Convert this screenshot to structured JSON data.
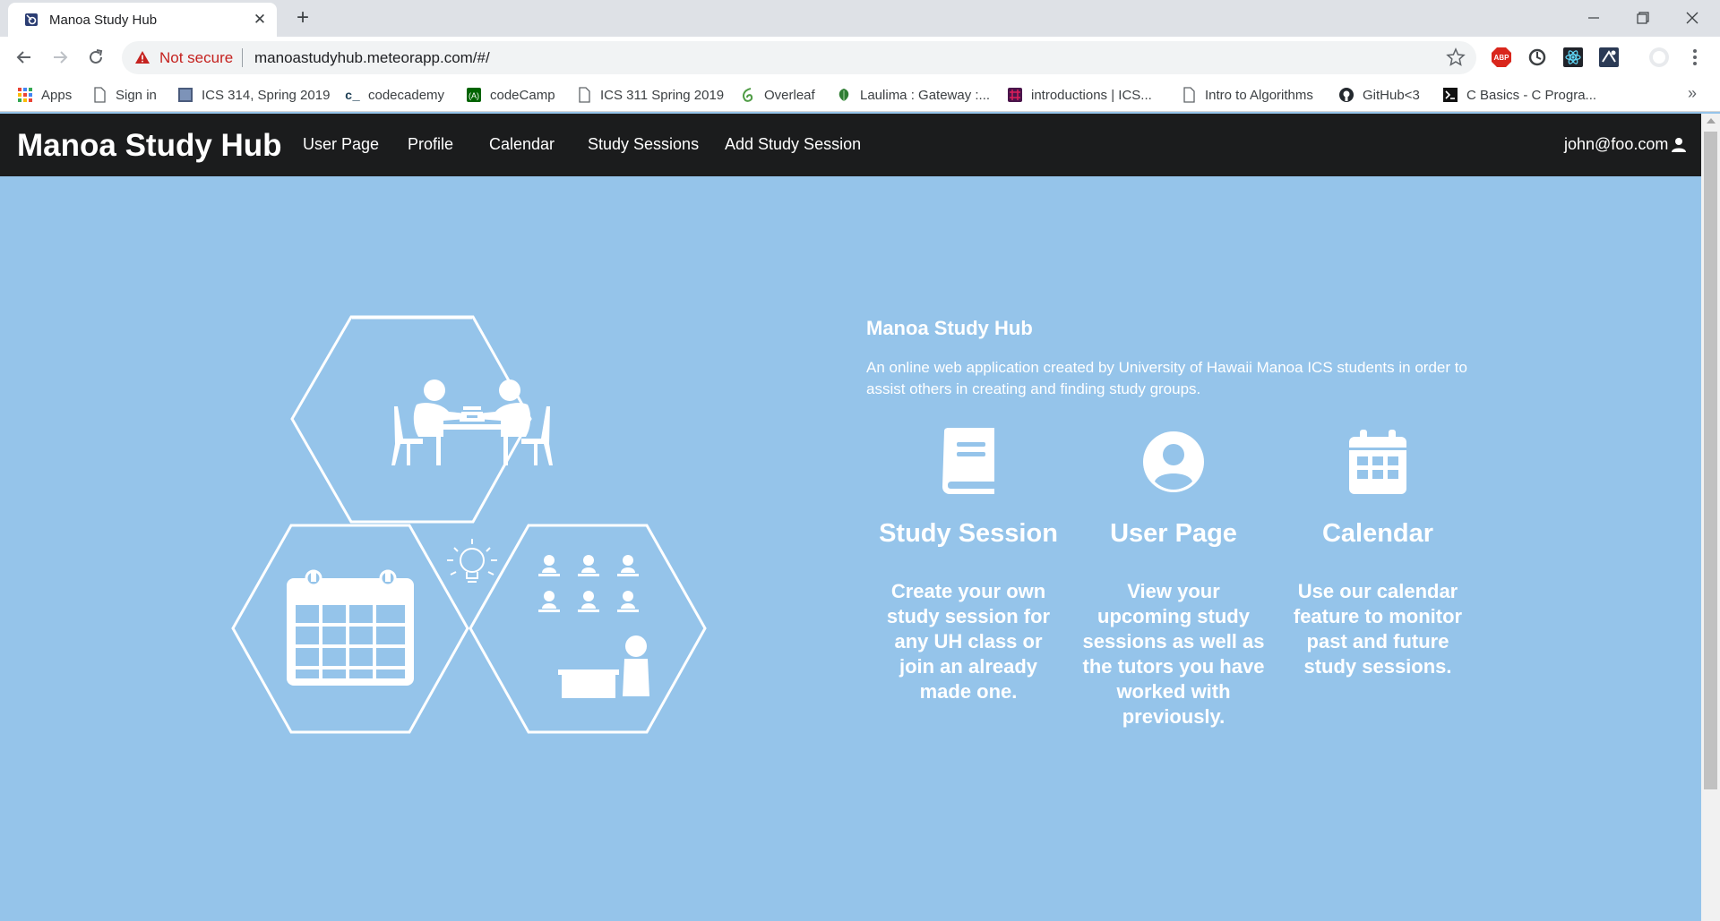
{
  "browser": {
    "tab_title": "Manoa Study Hub",
    "security_label": "Not secure",
    "url": "manoastudyhub.meteorapp.com/#/",
    "bookmarks": [
      {
        "label": "Apps"
      },
      {
        "label": "Sign in"
      },
      {
        "label": "ICS 314, Spring 2019"
      },
      {
        "label": "codecademy"
      },
      {
        "label": "codeCamp"
      },
      {
        "label": "ICS 311 Spring 2019"
      },
      {
        "label": "Overleaf"
      },
      {
        "label": "Laulima : Gateway :..."
      },
      {
        "label": "introductions | ICS..."
      },
      {
        "label": "Intro to Algorithms"
      },
      {
        "label": "GitHub<3"
      },
      {
        "label": "C Basics - C Progra..."
      }
    ],
    "extensions": [
      "adblock-icon",
      "sync-icon",
      "react-devtools-icon",
      "extension-icon",
      "profile-icon",
      "menu-icon"
    ]
  },
  "navbar": {
    "brand": "Manoa Study Hub",
    "items": [
      {
        "label": "User Page"
      },
      {
        "label": "Profile"
      },
      {
        "label": "Calendar"
      },
      {
        "label": "Study Sessions"
      },
      {
        "label": "Add Study Session"
      }
    ],
    "user": "john@foo.com"
  },
  "about": {
    "title": "Manoa Study Hub",
    "description": "An online web application created by University of Hawaii Manoa ICS students in order to assist others in creating and finding study groups."
  },
  "features": [
    {
      "icon": "book-icon",
      "title": "Study Session",
      "description": "Create your own study session for any UH class or join an already made one."
    },
    {
      "icon": "user-circle-icon",
      "title": "User Page",
      "description": "View your upcoming study sessions as well as the tutors you have worked with previously."
    },
    {
      "icon": "calendar-icon",
      "title": "Calendar",
      "description": "Use our calendar feature to monitor past and future study sessions."
    }
  ],
  "colors": {
    "background": "#95c4ea",
    "navbar": "#1b1c1d",
    "not_secure": "#c5221f"
  }
}
